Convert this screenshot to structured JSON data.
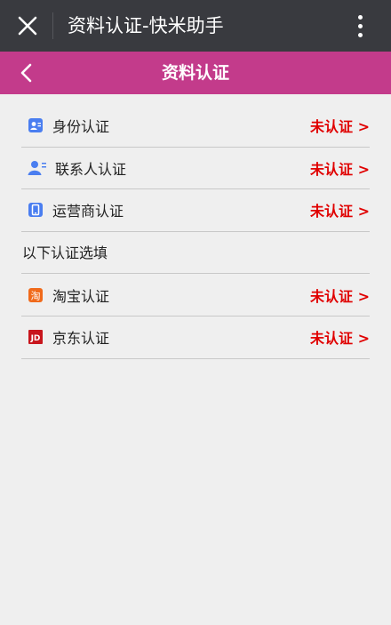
{
  "topbar": {
    "title": "资料认证-快米助手"
  },
  "header": {
    "title": "资料认证"
  },
  "items": [
    {
      "label": "身份认证",
      "status": "未认证 >",
      "icon": "id-card-icon"
    },
    {
      "label": "联系人认证",
      "status": "未认证 >",
      "icon": "contact-icon"
    },
    {
      "label": "运营商认证",
      "status": "未认证 >",
      "icon": "phone-icon"
    }
  ],
  "optional_section": {
    "title": "以下认证选填"
  },
  "optional_items": [
    {
      "label": "淘宝认证",
      "status": "未认证 >",
      "icon": "taobao-icon",
      "icon_text": "淘"
    },
    {
      "label": "京东认证",
      "status": "未认证 >",
      "icon": "jd-icon",
      "icon_text": "JD"
    }
  ],
  "colors": {
    "topbar": "#393a3f",
    "header": "#c33b8b",
    "status": "#e00000",
    "icon_blue": "#4a7ef0",
    "taobao": "#f06a1b",
    "jd": "#c8161d"
  }
}
